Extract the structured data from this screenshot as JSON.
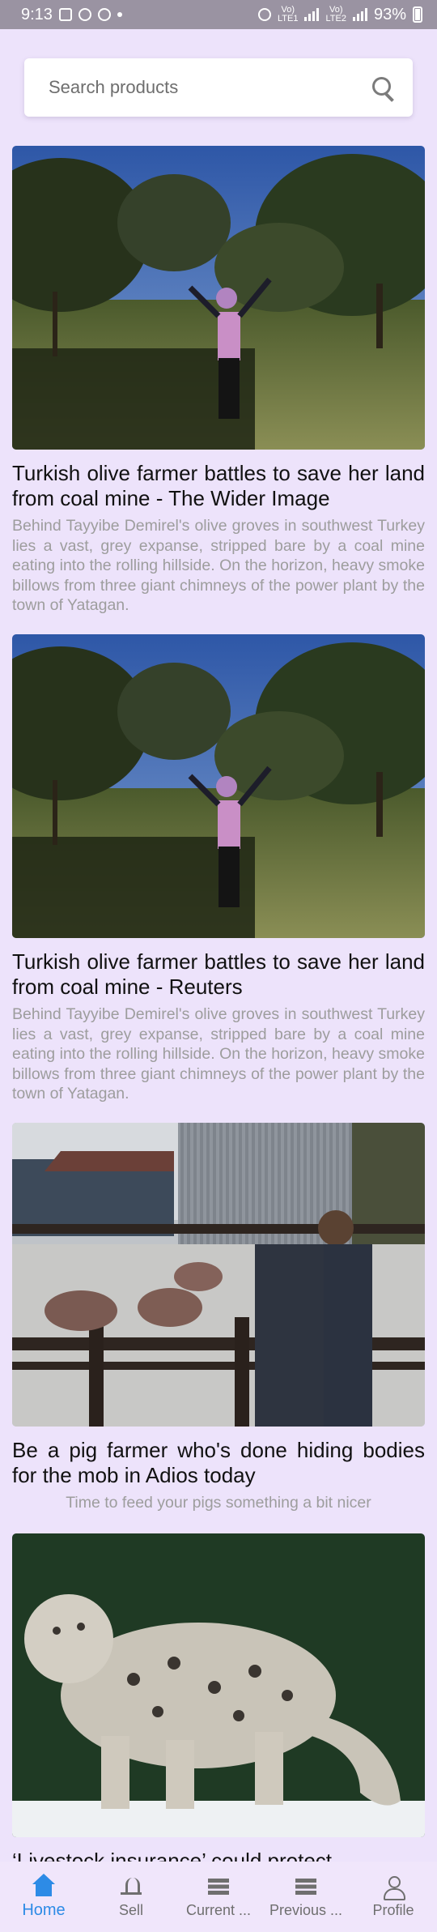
{
  "status_bar": {
    "time": "9:13",
    "battery": "93%",
    "network_1": "LTE1",
    "network_2": "LTE2",
    "volte": "Vo)"
  },
  "search": {
    "placeholder": "Search products"
  },
  "articles": [
    {
      "title": "Turkish olive farmer battles to save her land from coal mine - The Wider Image",
      "description": "Behind Tayyibe Demirel's olive groves in southwest Turkey lies a vast, grey expanse, stripped bare by a coal mine eating into the rolling hillside. On the horizon, heavy smoke billows from three giant chimneys of the power plant by the town of Yatagan.",
      "image": "olive-grove-woman-photo"
    },
    {
      "title": "Turkish olive farmer battles to save her land from coal mine - Reuters",
      "description": "Behind Tayyibe Demirel's olive groves in southwest Turkey lies a vast, grey expanse, stripped bare by a coal mine eating into the rolling hillside. On the horizon, heavy smoke billows from three giant chimneys of the power plant by the town of Yatagan.",
      "image": "olive-grove-woman-photo"
    },
    {
      "title": "Be a pig farmer who's done hiding bodies for the mob in Adios today",
      "description": "Time to feed your pigs something a bit nicer",
      "image": "pig-farm-game-screenshot"
    },
    {
      "title": "‘Livestock insurance’ could protect",
      "description": "",
      "image": "snow-leopard-photo"
    }
  ],
  "bottom_nav": [
    {
      "label": "Home",
      "icon": "home-icon",
      "active": true
    },
    {
      "label": "Sell",
      "icon": "sell-icon",
      "active": false
    },
    {
      "label": "Current ...",
      "icon": "list-icon",
      "active": false
    },
    {
      "label": "Previous ...",
      "icon": "list-icon",
      "active": false
    },
    {
      "label": "Profile",
      "icon": "profile-icon",
      "active": false
    }
  ],
  "colors": {
    "background": "#ede3fb",
    "status_bar": "#9a93a2",
    "accent": "#2d8be6",
    "description_text": "#9d9d9d"
  }
}
